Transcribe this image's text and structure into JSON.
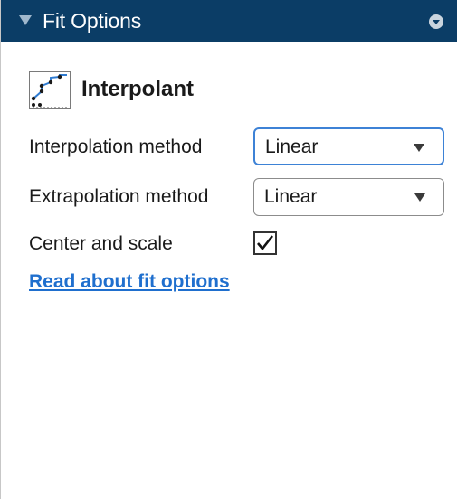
{
  "panel": {
    "title": "Fit Options",
    "title_chevron": "triangle-down-icon",
    "menu_icon": "circle-chevron-down-icon"
  },
  "fit_type": {
    "icon": "interpolant-plot-icon",
    "label": "Interpolant"
  },
  "options": {
    "interpolation_label": "Interpolation method",
    "interpolation_value": "Linear",
    "extrapolation_label": "Extrapolation method",
    "extrapolation_value": "Linear",
    "center_scale_label": "Center and scale",
    "center_scale_checked": true
  },
  "help": {
    "link_text": "Read about fit options"
  },
  "colors": {
    "titlebar": "#0b3d66",
    "link": "#1f6fce",
    "focus_border": "#3d82d6"
  }
}
